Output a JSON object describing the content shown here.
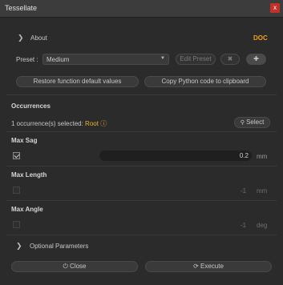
{
  "window": {
    "title": "Tessellate",
    "close_label": "x"
  },
  "about": {
    "label": "About",
    "doc_label": "DOC"
  },
  "preset": {
    "label": "Preset :",
    "value": "Medium",
    "edit_label": "Edit Preset"
  },
  "actions": {
    "restore_label": "Restore function default values",
    "copy_label": "Copy Python code to clipboard"
  },
  "occurrences": {
    "header": "Occurrences",
    "selected_text": "1 occurrence(s) selected: ",
    "selected_item": "Root",
    "select_label": "Select"
  },
  "params": [
    {
      "name": "Max Sag",
      "checked": true,
      "value": "0.2",
      "unit": "mm"
    },
    {
      "name": "Max Length",
      "checked": false,
      "value": "-1",
      "unit": "mm"
    },
    {
      "name": "Max Angle",
      "checked": false,
      "value": "-1",
      "unit": "deg"
    }
  ],
  "optional": {
    "label": "Optional Parameters"
  },
  "footer": {
    "close_label": "Close",
    "execute_label": "Execute"
  },
  "icons": [
    "chevron-right-icon",
    "dropdown-arrow-icon",
    "clear-icon",
    "plus-icon",
    "search-icon",
    "info-icon",
    "power-icon",
    "refresh-icon"
  ],
  "colors": {
    "accent": "#f0a020",
    "close": "#c2302c",
    "background": "#2b2b2b"
  }
}
